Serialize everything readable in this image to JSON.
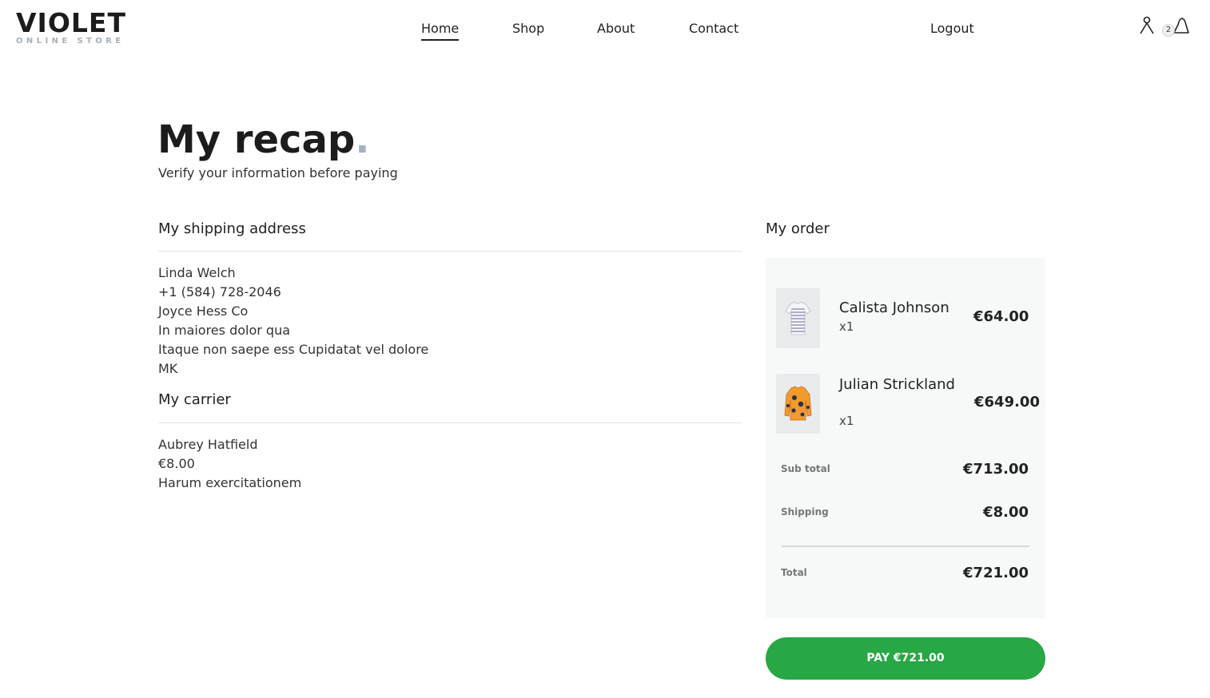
{
  "brand": {
    "name": "VIOLET",
    "tagline": "ONLINE STORE"
  },
  "nav": {
    "items": [
      {
        "label": "Home",
        "active": true
      },
      {
        "label": "Shop",
        "active": false
      },
      {
        "label": "About",
        "active": false
      },
      {
        "label": "Contact",
        "active": false
      }
    ],
    "logout_label": "Logout",
    "cart_count": "2",
    "icons": {
      "account": "user-icon",
      "cart": "shopping-bag-icon"
    }
  },
  "page": {
    "title": "My recap",
    "title_dot": ".",
    "subtitle": "Verify your information before paying"
  },
  "shipping": {
    "title": "My shipping address",
    "lines": [
      "Linda Welch",
      "+1 (584) 728-2046",
      "Joyce Hess Co",
      "In maiores dolor qua",
      "Itaque non saepe ess Cupidatat vel dolore",
      "MK"
    ]
  },
  "carrier": {
    "title": "My carrier",
    "lines": [
      "Aubrey Hatfield",
      "€8.00",
      "Harum exercitationem"
    ]
  },
  "order": {
    "title": "My order",
    "items": [
      {
        "name": "Calista Johnson",
        "qty": "x1",
        "price": "€64.00",
        "image": "striped-tshirt-thumbnail"
      },
      {
        "name": "Julian Strickland",
        "qty": "x1",
        "price": "€649.00",
        "image": "orange-sweater-thumbnail"
      }
    ],
    "subtotal_label": "Sub total",
    "subtotal": "€713.00",
    "shipping_label": "Shipping",
    "shipping": "€8.00",
    "total_label": "Total",
    "total": "€721.00"
  },
  "pay_button_label": "PAY €721.00",
  "colors": {
    "accent_button": "#28a745",
    "title_dot": "#a7b0c2",
    "order_panel_bg": "#f7f8f8"
  }
}
